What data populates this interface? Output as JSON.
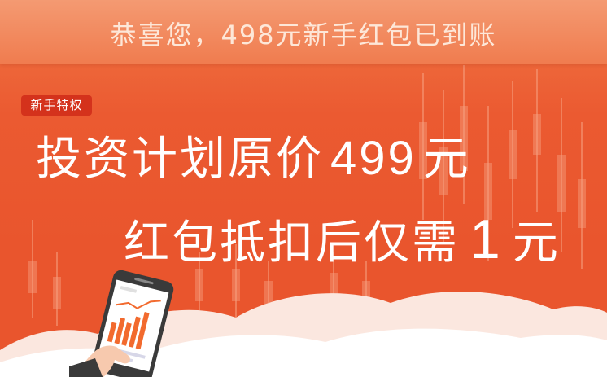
{
  "header": {
    "title": "恭喜您，498元新手红包已到账"
  },
  "badge": {
    "label": "新手特权"
  },
  "offer": {
    "line1_prefix": "投资计划原价",
    "line1_price": "499",
    "line1_unit": "元",
    "line2_prefix": "红包抵扣后仅需",
    "line2_price": "1",
    "line2_unit": "元"
  },
  "colors": {
    "background": "#e9552d",
    "header_bg": "#f49a72",
    "badge_bg": "#d4321c",
    "phone_body": "#3a3a3a",
    "chart_accent": "#f26a2e"
  },
  "icons": [
    "phone-icon",
    "hand-icon",
    "bar-chart-icon"
  ]
}
